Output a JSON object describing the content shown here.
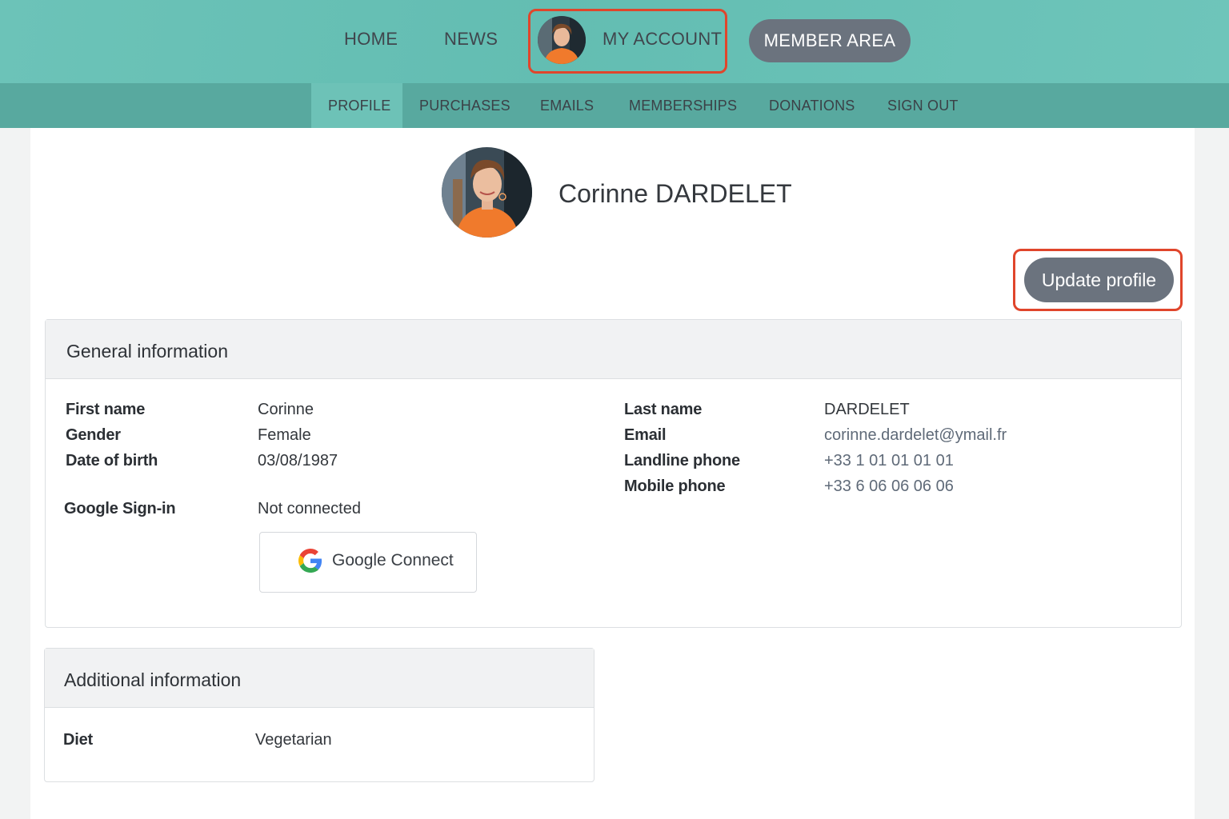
{
  "topnav": {
    "home": "HOME",
    "news": "NEWS",
    "account": "MY ACCOUNT",
    "member_area": "MEMBER AREA"
  },
  "subnav": {
    "profile": "PROFILE",
    "purchases": "PURCHASES",
    "emails": "EMAILS",
    "memberships": "MEMBERSHIPS",
    "donations": "DONATIONS",
    "sign_out": "SIGN OUT"
  },
  "profile": {
    "name": "Corinne DARDELET",
    "update_button": "Update profile"
  },
  "general": {
    "title": "General information",
    "first_name_label": "First name",
    "first_name": "Corinne",
    "gender_label": "Gender",
    "gender": "Female",
    "dob_label": "Date of birth",
    "dob": "03/08/1987",
    "google_label": "Google Sign-in",
    "google_status": "Not connected",
    "google_button": "Google Connect",
    "last_name_label": "Last name",
    "last_name": "DARDELET",
    "email_label": "Email",
    "email": "corinne.dardelet@ymail.fr",
    "landline_label": "Landline phone",
    "landline": "+33 1 01 01 01 01",
    "mobile_label": "Mobile phone",
    "mobile": "+33 6 06 06 06 06"
  },
  "additional": {
    "title": "Additional information",
    "diet_label": "Diet",
    "diet": "Vegetarian"
  },
  "colors": {
    "topbar": "#63bdb2",
    "subbar": "#58a99f",
    "button": "#6b737e",
    "highlight": "#e0452b"
  }
}
